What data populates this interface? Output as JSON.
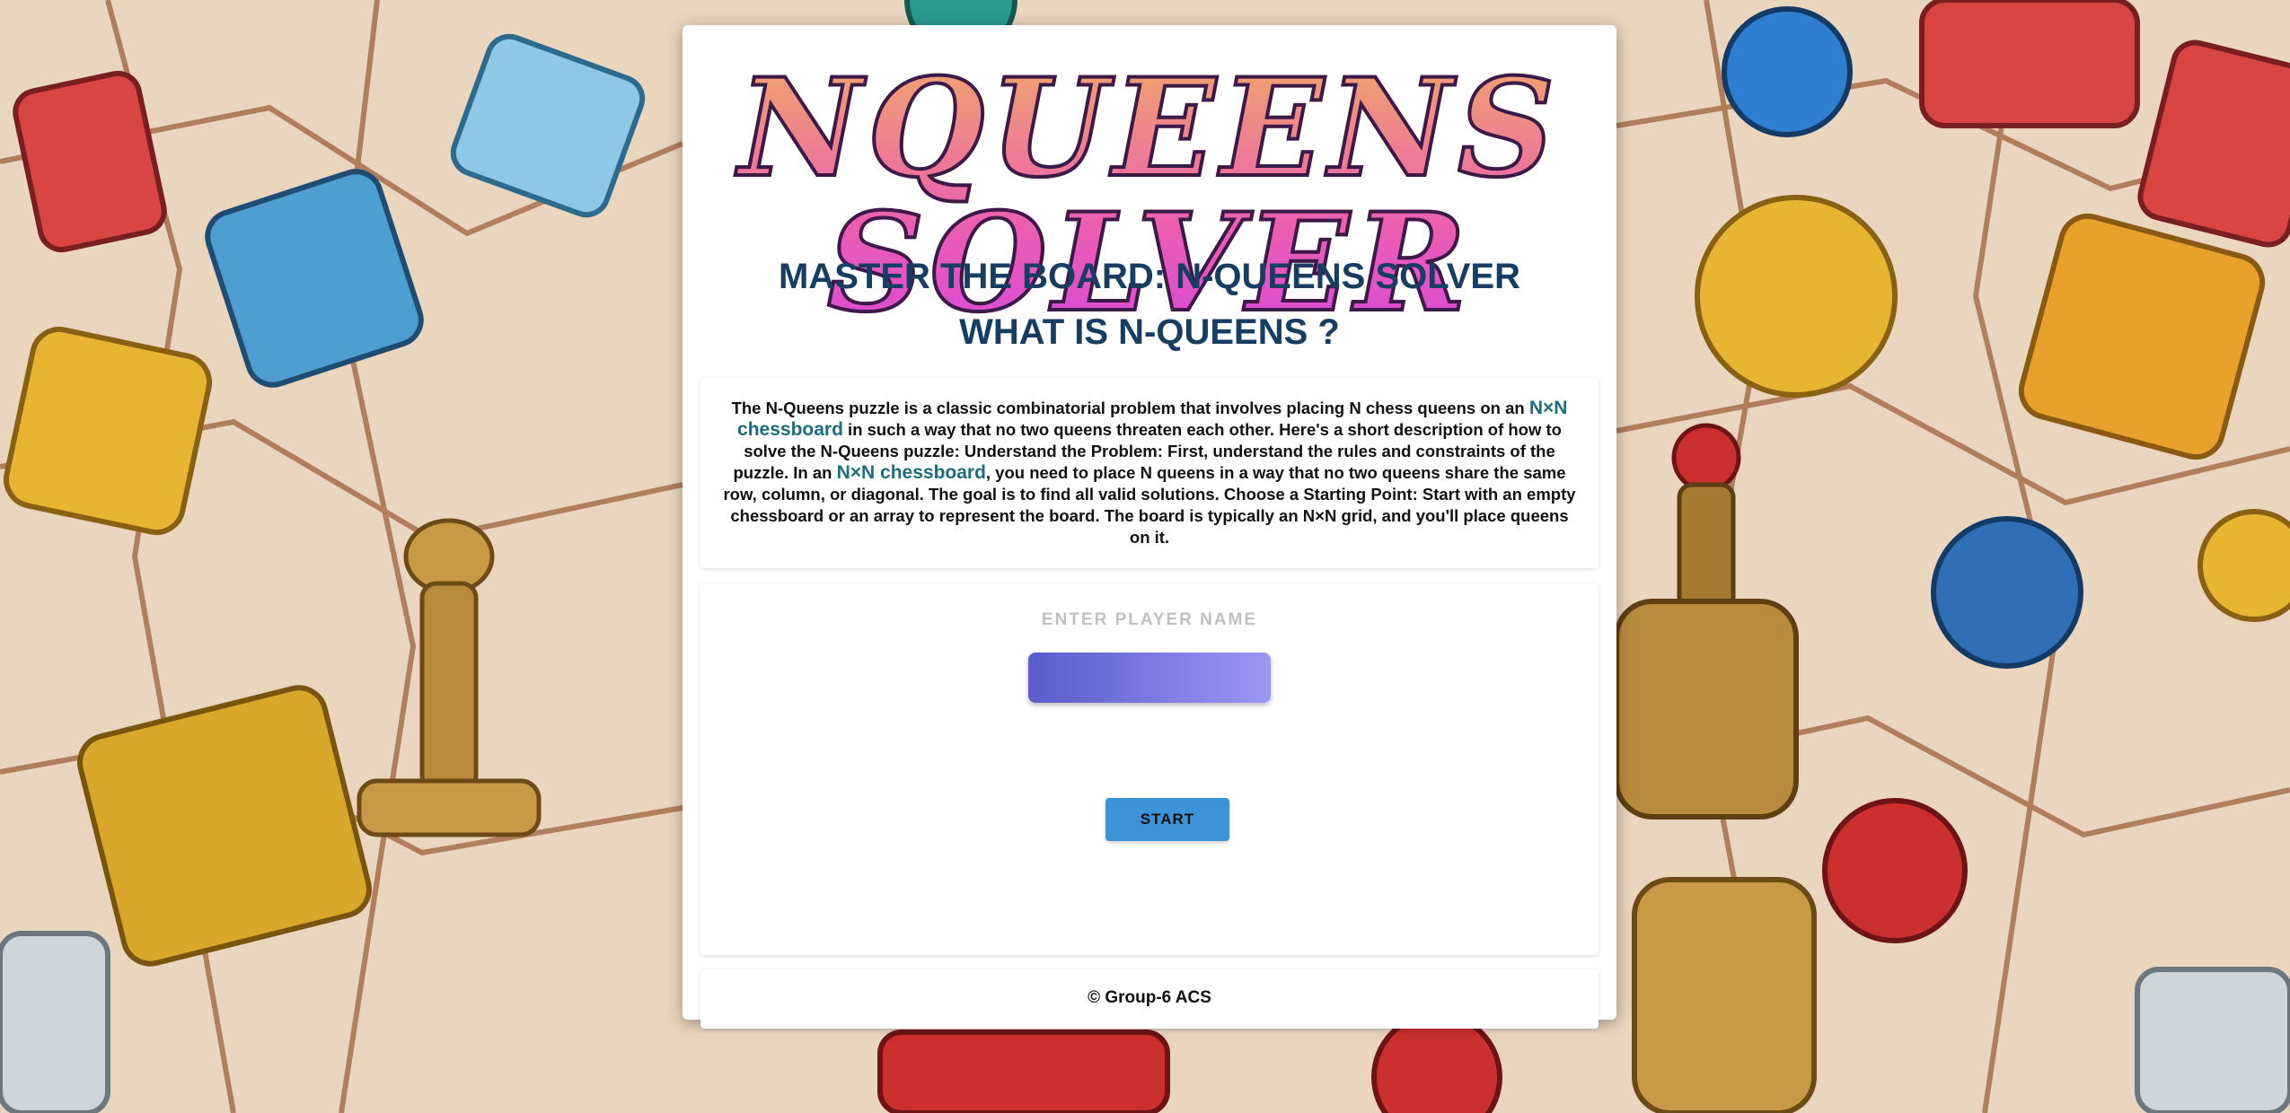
{
  "logo": {
    "text": "NQUEENS SOLVER"
  },
  "headings": {
    "title": "MASTER THE BOARD: N-QUEENS SOLVER",
    "subtitle": "WHAT IS N-QUEENS ?"
  },
  "description": {
    "part1": "The N-Queens puzzle is a classic combinatorial problem that involves placing N chess queens on an ",
    "highlight1": "N×N chessboard",
    "part2": " in such a way that no two queens threaten each other. Here's a short description of how to solve the N-Queens puzzle: Understand the Problem: First, understand the rules and constraints of the puzzle. In an ",
    "highlight2": "N×N chessboard",
    "part3": ", you need to place N queens in a way that no two queens share the same row, column, or diagonal. The goal is to find all valid solutions. Choose a Starting Point: Start with an empty chessboard or an array to represent the board. The board is typically an N×N grid, and you'll place queens on it."
  },
  "form": {
    "player_label": "ENTER PLAYER NAME",
    "name_value": "",
    "start_label": "START"
  },
  "footer": {
    "text": "© Group-6 ACS"
  },
  "colors": {
    "heading": "#173d63",
    "highlight": "#1c6e7e",
    "start_button": "#3d93d6",
    "input_gradient_start": "#5b5ccc",
    "input_gradient_end": "#9a97f4"
  }
}
